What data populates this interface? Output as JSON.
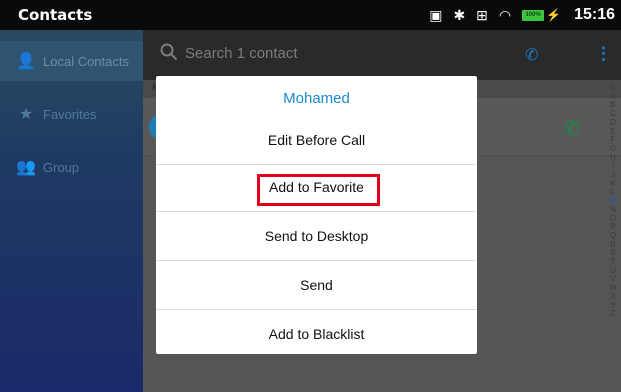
{
  "status_bar": {
    "app_title": "Contacts",
    "time": "15:16",
    "battery": "100%"
  },
  "sidebar": {
    "items": [
      {
        "label": "Local Contacts",
        "icon": "person-icon",
        "active": true
      },
      {
        "label": "Favorites",
        "icon": "star-icon",
        "active": false
      },
      {
        "label": "Group",
        "icon": "group-icon",
        "active": false
      }
    ]
  },
  "search": {
    "placeholder": "Search 1 contact"
  },
  "list": {
    "section_letter": "M"
  },
  "alphabet": [
    "#",
    "A",
    "B",
    "C",
    "D",
    "E",
    "F",
    "G",
    "H",
    "I",
    "J",
    "K",
    "L",
    "M",
    "N",
    "O",
    "P",
    "Q",
    "R",
    "S",
    "T",
    "U",
    "V",
    "W",
    "X",
    "Y",
    "Z"
  ],
  "dialog": {
    "title": "Mohamed",
    "options": [
      "Edit Before Call",
      "Add to Favorite",
      "Send to Desktop",
      "Send",
      "Add to Blacklist"
    ]
  },
  "colors": {
    "accent": "#1a8ad0",
    "highlight_box": "#e4001b",
    "call_green": "#1a8c4a"
  }
}
